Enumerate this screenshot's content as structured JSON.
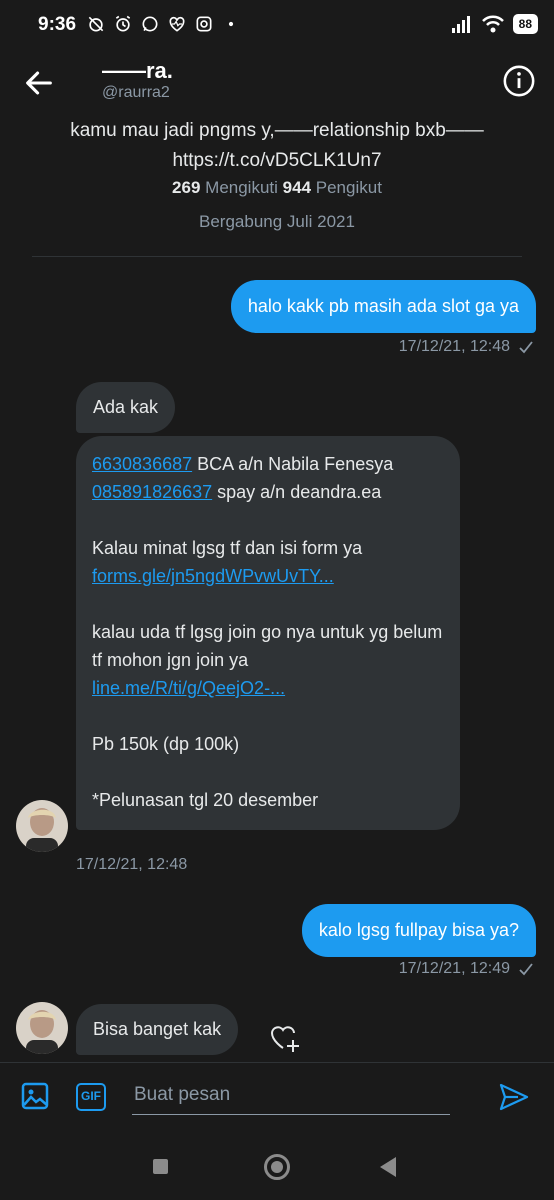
{
  "status_bar": {
    "time": "9:36",
    "battery": "88",
    "icons_left": [
      "alarm-off-icon",
      "alarm-icon",
      "whatsapp-icon",
      "health-icon",
      "instagram-icon",
      "dot-icon"
    ],
    "icons_right": [
      "signal-icon",
      "wifi-icon",
      "battery-icon"
    ]
  },
  "header": {
    "name": "——ra.",
    "handle": "@raurra2",
    "back_icon": "arrow-left-icon",
    "info_icon": "info-icon"
  },
  "profile": {
    "bio_line1": "kamu mau jadi pngms y,——relationship bxb——",
    "bio_line2": "https://t.co/vD5CLK1Un7",
    "following_count": "269",
    "following_label": "Mengikuti",
    "followers_count": "944",
    "followers_label": "Pengikut",
    "joined": "Bergabung Juli 2021"
  },
  "messages": {
    "m1": {
      "text": "halo kakk pb masih ada slot ga ya",
      "time": "17/12/21, 12:48"
    },
    "m2": {
      "text": "Ada kak"
    },
    "m3": {
      "link1": "6630836687",
      "text1": " BCA a/n Nabila Fenesya",
      "link2": "085891826637",
      "text2": " spay a/n deandra.ea",
      "text3": "Kalau minat lgsg tf dan isi form ya",
      "link3": "forms.gle/jn5ngdWPvwUvTY...",
      "text4": "kalau uda tf lgsg join go nya untuk yg belum tf mohon jgn join ya",
      "link4": "line.me/R/ti/g/QeejO2-...",
      "text5": "Pb 150k (dp 100k)",
      "text6": "*Pelunasan tgl 20 desember",
      "time": "17/12/21, 12:48"
    },
    "m4": {
      "text": "kalo lgsg fullpay bisa ya?",
      "time": "17/12/21, 12:49"
    },
    "m5": {
      "text": "Bisa banget kak"
    }
  },
  "composer": {
    "placeholder": "Buat pesan",
    "gif_label": "GIF",
    "media_icon": "image-icon",
    "send_icon": "send-icon"
  },
  "colors": {
    "accent": "#1d9bf0",
    "background": "#1a1a1a",
    "incoming_bubble": "#2f3336",
    "muted_text": "#8b98a5"
  }
}
